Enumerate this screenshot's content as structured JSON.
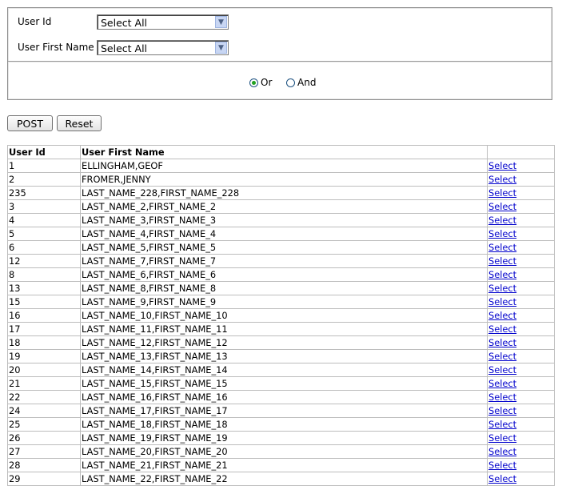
{
  "filters": {
    "user_id_label": "User Id",
    "user_id_value": "Select All",
    "first_name_label": "User First Name",
    "first_name_value": "Select All",
    "or_label": "Or",
    "and_label": "And",
    "selected_mode": "Or"
  },
  "buttons": {
    "post": "POST",
    "reset": "Reset"
  },
  "table": {
    "headers": [
      "User Id",
      "User First Name",
      ""
    ],
    "link_label": "Select",
    "rows": [
      [
        "1",
        "ELLINGHAM,GEOF"
      ],
      [
        "2",
        "FROMER,JENNY"
      ],
      [
        "235",
        "LAST_NAME_228,FIRST_NAME_228"
      ],
      [
        "3",
        "LAST_NAME_2,FIRST_NAME_2"
      ],
      [
        "4",
        "LAST_NAME_3,FIRST_NAME_3"
      ],
      [
        "5",
        "LAST_NAME_4,FIRST_NAME_4"
      ],
      [
        "6",
        "LAST_NAME_5,FIRST_NAME_5"
      ],
      [
        "12",
        "LAST_NAME_7,FIRST_NAME_7"
      ],
      [
        "8",
        "LAST_NAME_6,FIRST_NAME_6"
      ],
      [
        "13",
        "LAST_NAME_8,FIRST_NAME_8"
      ],
      [
        "15",
        "LAST_NAME_9,FIRST_NAME_9"
      ],
      [
        "16",
        "LAST_NAME_10,FIRST_NAME_10"
      ],
      [
        "17",
        "LAST_NAME_11,FIRST_NAME_11"
      ],
      [
        "18",
        "LAST_NAME_12,FIRST_NAME_12"
      ],
      [
        "19",
        "LAST_NAME_13,FIRST_NAME_13"
      ],
      [
        "20",
        "LAST_NAME_14,FIRST_NAME_14"
      ],
      [
        "21",
        "LAST_NAME_15,FIRST_NAME_15"
      ],
      [
        "22",
        "LAST_NAME_16,FIRST_NAME_16"
      ],
      [
        "24",
        "LAST_NAME_17,FIRST_NAME_17"
      ],
      [
        "25",
        "LAST_NAME_18,FIRST_NAME_18"
      ],
      [
        "26",
        "LAST_NAME_19,FIRST_NAME_19"
      ],
      [
        "27",
        "LAST_NAME_20,FIRST_NAME_20"
      ],
      [
        "28",
        "LAST_NAME_21,FIRST_NAME_21"
      ],
      [
        "29",
        "LAST_NAME_22,FIRST_NAME_22"
      ]
    ]
  }
}
